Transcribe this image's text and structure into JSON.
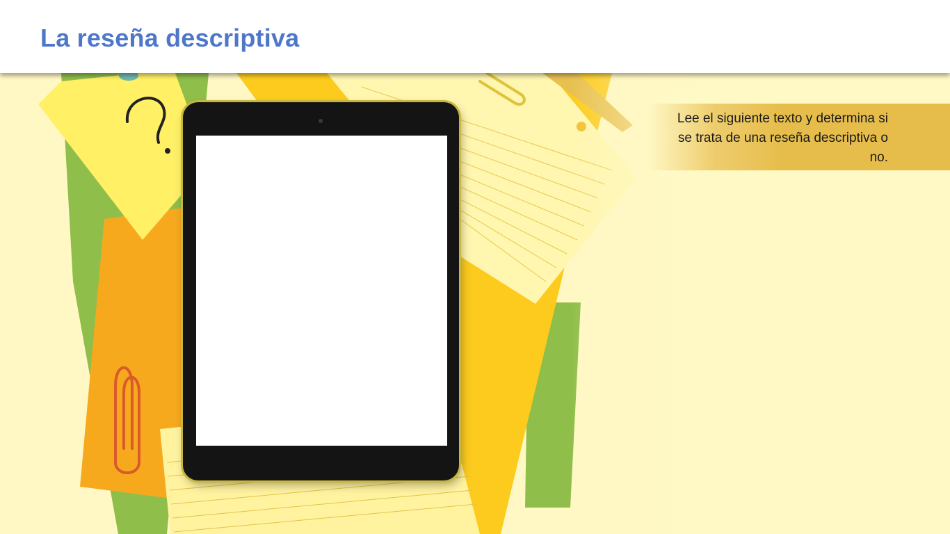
{
  "header": {
    "title": "La reseña descriptiva"
  },
  "instruction": {
    "text": "Lee el siguiente texto y determina si se trata de una reseña descriptiva o no."
  },
  "tablet": {
    "screen_text": ""
  },
  "decor": {
    "icons": [
      "question-mark-icon",
      "paperclip-icon",
      "paperclip-icon",
      "push-pin-icon"
    ],
    "colors": {
      "title": "#4f77c9",
      "band": "#e6bd4b",
      "background": "#fff8c4"
    }
  }
}
